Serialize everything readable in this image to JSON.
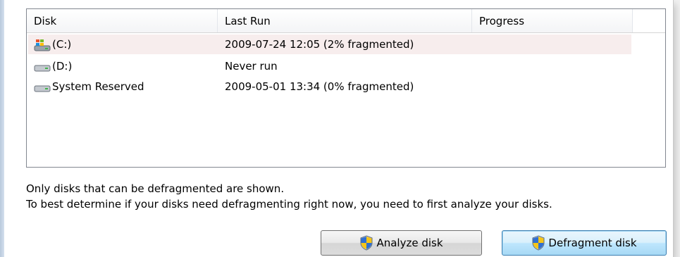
{
  "list": {
    "headers": [
      "Disk",
      "Last Run",
      "Progress"
    ],
    "rows": [
      {
        "disk": "(C:)",
        "last_run": "2009-07-24 12:05 (2% fragmented)",
        "progress": "",
        "icon": "system-drive-icon",
        "selected": true
      },
      {
        "disk": "(D:)",
        "last_run": "Never run",
        "progress": "",
        "icon": "hard-drive-icon",
        "selected": false
      },
      {
        "disk": "System Reserved",
        "last_run": "2009-05-01 13:34 (0% fragmented)",
        "progress": "",
        "icon": "hard-drive-icon",
        "selected": false
      }
    ]
  },
  "info": {
    "line1": "Only disks that can be defragmented are shown.",
    "line2": "To best determine if your disks need defragmenting right now, you need to first analyze your disks."
  },
  "buttons": {
    "analyze_label": "Analyze disk",
    "defragment_label": "Defragment disk",
    "icon": "uac-shield-icon"
  },
  "colors": {
    "selected_row": "#f7eded",
    "default_button_border": "#3c7fb1"
  }
}
